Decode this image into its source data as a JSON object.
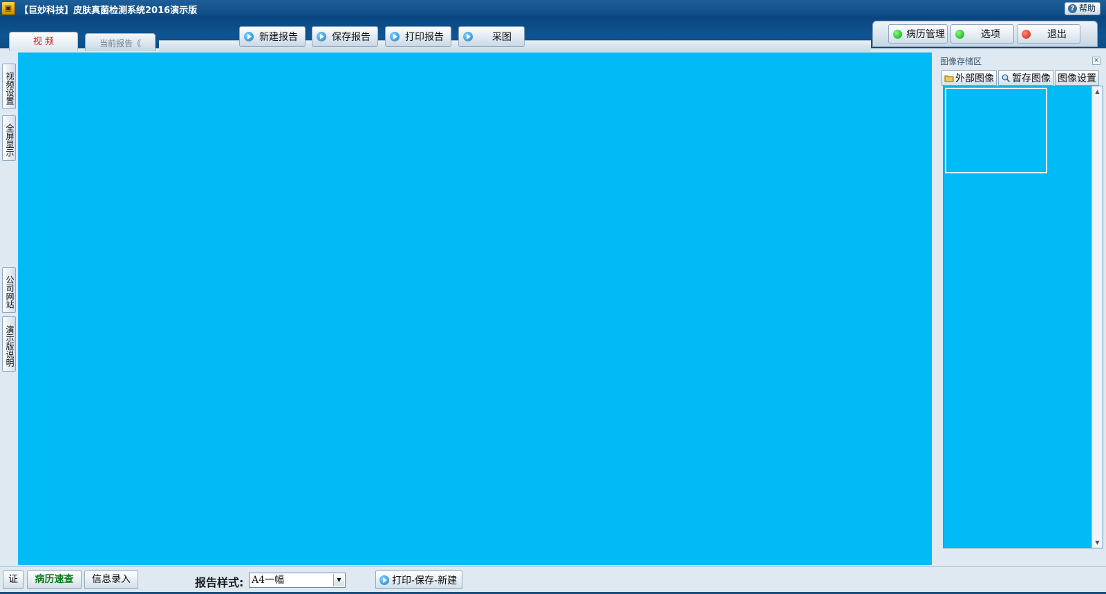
{
  "window": {
    "title": "【巨妙科技】皮肤真菌检测系统2016演示版",
    "help_label": "帮助"
  },
  "tabs": {
    "video": "视  频",
    "current_report": "当前报告《"
  },
  "toolbar": {
    "new_report": "新建报告",
    "save_report": "保存报告",
    "print_report": "打印报告",
    "capture": "采图"
  },
  "top_right": {
    "records": "病历管理",
    "options": "选项",
    "exit": "退出"
  },
  "side": {
    "video_settings": "视频设置",
    "fullscreen": "全屏显示",
    "company_site": "公司网站",
    "demo_notes": "演示版说明"
  },
  "storage": {
    "title": "图像存储区",
    "tab_external": "外部图像",
    "tab_temp": "暂存图像",
    "tab_settings": "图像设置"
  },
  "bottom": {
    "cert": "证",
    "quick_records": "病历速查",
    "info_entry": "信息录入",
    "style_label": "报告样式:",
    "style_value": "A4一幅",
    "print_save_new": "打印-保存-新建"
  },
  "colors": {
    "video_area": "#00bbf6",
    "title_bar": "#0c4a83",
    "panel_bg": "#dfe9f2",
    "video_tab_text": "#d21414",
    "records_text": "#0b7a16"
  }
}
